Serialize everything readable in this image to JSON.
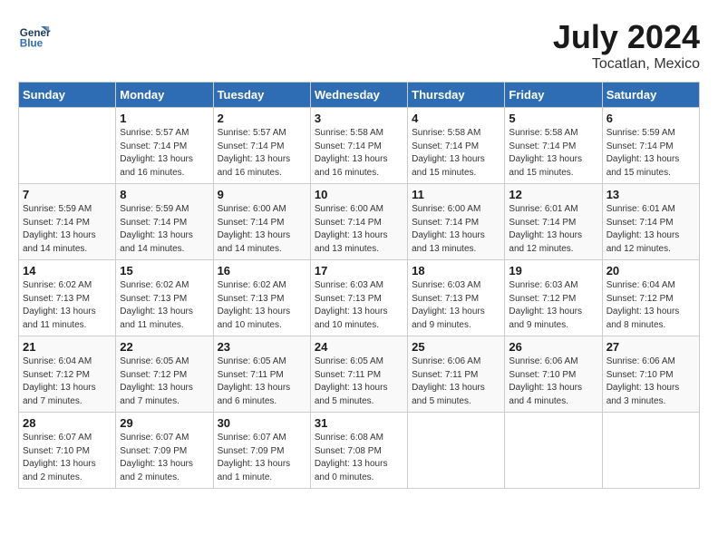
{
  "header": {
    "logo_line1": "General",
    "logo_line2": "Blue",
    "month": "July 2024",
    "location": "Tocatlan, Mexico"
  },
  "days_of_week": [
    "Sunday",
    "Monday",
    "Tuesday",
    "Wednesday",
    "Thursday",
    "Friday",
    "Saturday"
  ],
  "weeks": [
    [
      {
        "day": "",
        "info": ""
      },
      {
        "day": "1",
        "info": "Sunrise: 5:57 AM\nSunset: 7:14 PM\nDaylight: 13 hours\nand 16 minutes."
      },
      {
        "day": "2",
        "info": "Sunrise: 5:57 AM\nSunset: 7:14 PM\nDaylight: 13 hours\nand 16 minutes."
      },
      {
        "day": "3",
        "info": "Sunrise: 5:58 AM\nSunset: 7:14 PM\nDaylight: 13 hours\nand 16 minutes."
      },
      {
        "day": "4",
        "info": "Sunrise: 5:58 AM\nSunset: 7:14 PM\nDaylight: 13 hours\nand 15 minutes."
      },
      {
        "day": "5",
        "info": "Sunrise: 5:58 AM\nSunset: 7:14 PM\nDaylight: 13 hours\nand 15 minutes."
      },
      {
        "day": "6",
        "info": "Sunrise: 5:59 AM\nSunset: 7:14 PM\nDaylight: 13 hours\nand 15 minutes."
      }
    ],
    [
      {
        "day": "7",
        "info": "Sunrise: 5:59 AM\nSunset: 7:14 PM\nDaylight: 13 hours\nand 14 minutes."
      },
      {
        "day": "8",
        "info": "Sunrise: 5:59 AM\nSunset: 7:14 PM\nDaylight: 13 hours\nand 14 minutes."
      },
      {
        "day": "9",
        "info": "Sunrise: 6:00 AM\nSunset: 7:14 PM\nDaylight: 13 hours\nand 14 minutes."
      },
      {
        "day": "10",
        "info": "Sunrise: 6:00 AM\nSunset: 7:14 PM\nDaylight: 13 hours\nand 13 minutes."
      },
      {
        "day": "11",
        "info": "Sunrise: 6:00 AM\nSunset: 7:14 PM\nDaylight: 13 hours\nand 13 minutes."
      },
      {
        "day": "12",
        "info": "Sunrise: 6:01 AM\nSunset: 7:14 PM\nDaylight: 13 hours\nand 12 minutes."
      },
      {
        "day": "13",
        "info": "Sunrise: 6:01 AM\nSunset: 7:14 PM\nDaylight: 13 hours\nand 12 minutes."
      }
    ],
    [
      {
        "day": "14",
        "info": "Sunrise: 6:02 AM\nSunset: 7:13 PM\nDaylight: 13 hours\nand 11 minutes."
      },
      {
        "day": "15",
        "info": "Sunrise: 6:02 AM\nSunset: 7:13 PM\nDaylight: 13 hours\nand 11 minutes."
      },
      {
        "day": "16",
        "info": "Sunrise: 6:02 AM\nSunset: 7:13 PM\nDaylight: 13 hours\nand 10 minutes."
      },
      {
        "day": "17",
        "info": "Sunrise: 6:03 AM\nSunset: 7:13 PM\nDaylight: 13 hours\nand 10 minutes."
      },
      {
        "day": "18",
        "info": "Sunrise: 6:03 AM\nSunset: 7:13 PM\nDaylight: 13 hours\nand 9 minutes."
      },
      {
        "day": "19",
        "info": "Sunrise: 6:03 AM\nSunset: 7:12 PM\nDaylight: 13 hours\nand 9 minutes."
      },
      {
        "day": "20",
        "info": "Sunrise: 6:04 AM\nSunset: 7:12 PM\nDaylight: 13 hours\nand 8 minutes."
      }
    ],
    [
      {
        "day": "21",
        "info": "Sunrise: 6:04 AM\nSunset: 7:12 PM\nDaylight: 13 hours\nand 7 minutes."
      },
      {
        "day": "22",
        "info": "Sunrise: 6:05 AM\nSunset: 7:12 PM\nDaylight: 13 hours\nand 7 minutes."
      },
      {
        "day": "23",
        "info": "Sunrise: 6:05 AM\nSunset: 7:11 PM\nDaylight: 13 hours\nand 6 minutes."
      },
      {
        "day": "24",
        "info": "Sunrise: 6:05 AM\nSunset: 7:11 PM\nDaylight: 13 hours\nand 5 minutes."
      },
      {
        "day": "25",
        "info": "Sunrise: 6:06 AM\nSunset: 7:11 PM\nDaylight: 13 hours\nand 5 minutes."
      },
      {
        "day": "26",
        "info": "Sunrise: 6:06 AM\nSunset: 7:10 PM\nDaylight: 13 hours\nand 4 minutes."
      },
      {
        "day": "27",
        "info": "Sunrise: 6:06 AM\nSunset: 7:10 PM\nDaylight: 13 hours\nand 3 minutes."
      }
    ],
    [
      {
        "day": "28",
        "info": "Sunrise: 6:07 AM\nSunset: 7:10 PM\nDaylight: 13 hours\nand 2 minutes."
      },
      {
        "day": "29",
        "info": "Sunrise: 6:07 AM\nSunset: 7:09 PM\nDaylight: 13 hours\nand 2 minutes."
      },
      {
        "day": "30",
        "info": "Sunrise: 6:07 AM\nSunset: 7:09 PM\nDaylight: 13 hours\nand 1 minute."
      },
      {
        "day": "31",
        "info": "Sunrise: 6:08 AM\nSunset: 7:08 PM\nDaylight: 13 hours\nand 0 minutes."
      },
      {
        "day": "",
        "info": ""
      },
      {
        "day": "",
        "info": ""
      },
      {
        "day": "",
        "info": ""
      }
    ]
  ]
}
